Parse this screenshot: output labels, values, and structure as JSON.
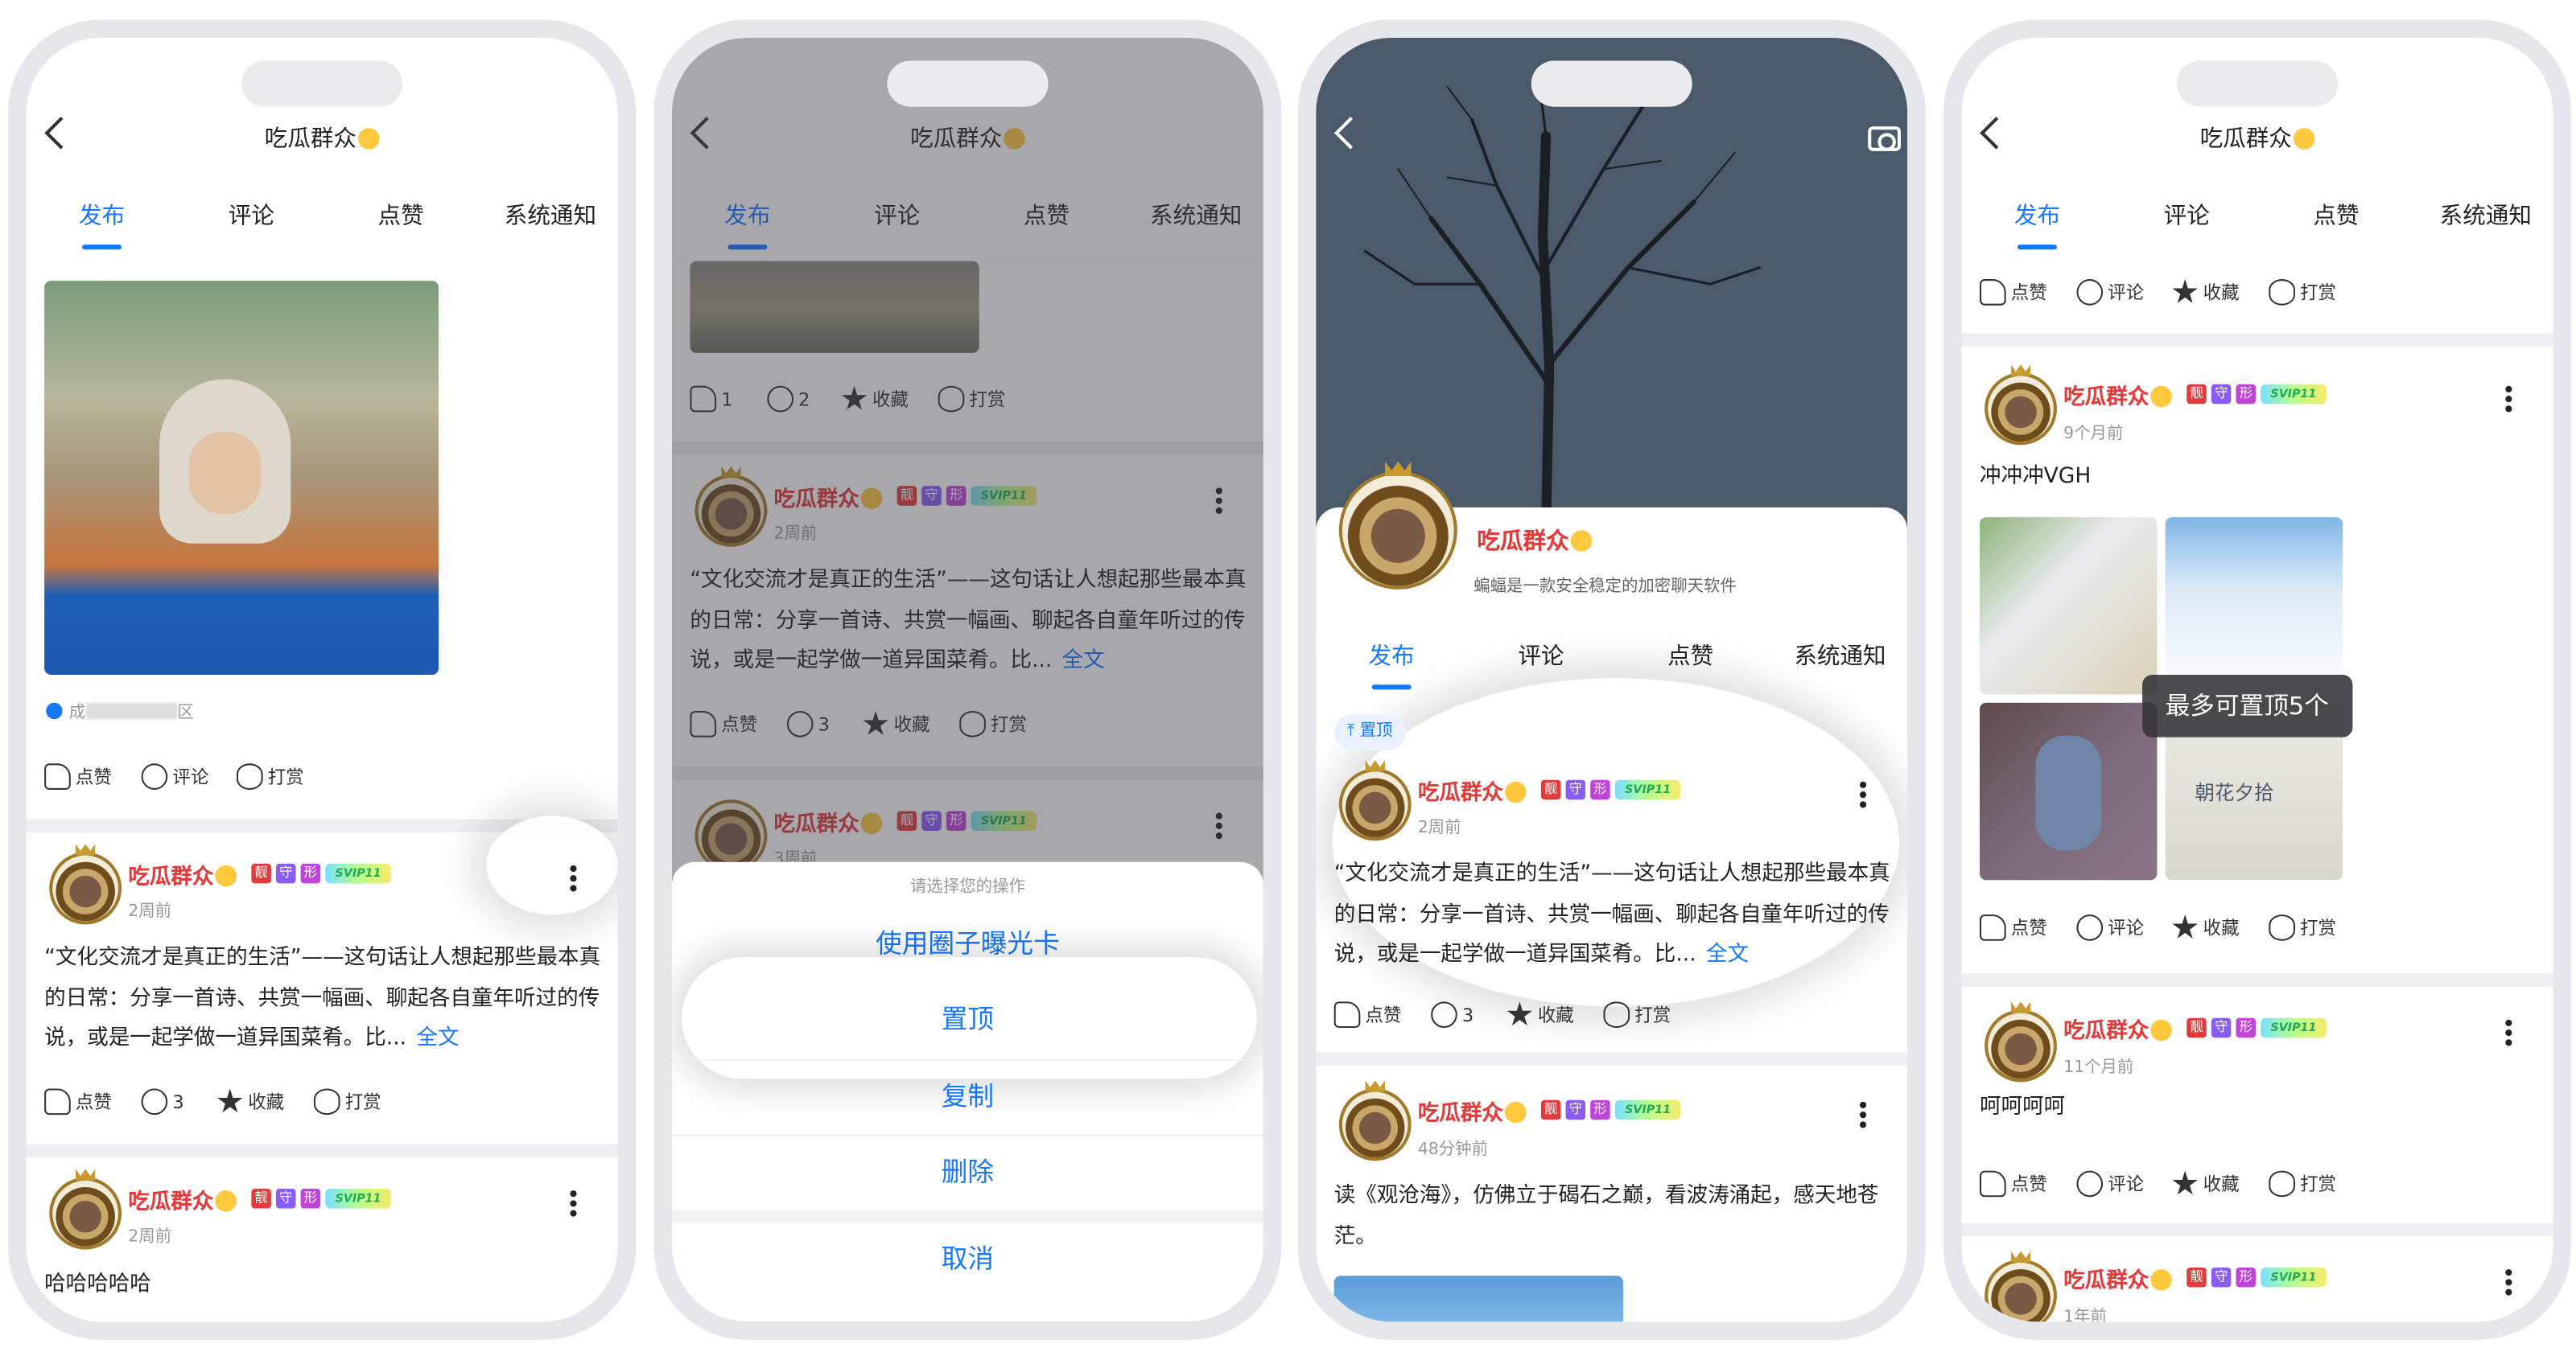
{
  "title": "吃瓜群众",
  "tabs": [
    "发布",
    "评论",
    "点赞",
    "系统通知"
  ],
  "user": {
    "name": "吃瓜群众",
    "badges": [
      "靓",
      "守",
      "形"
    ],
    "svip": "SVIP11",
    "signature": "蝙蝠是一款安全稳定的加密聊天软件"
  },
  "colors": {
    "accent": "#1677ff",
    "username": "#e33b3b",
    "background": "#efeff3"
  },
  "icons": [
    "back-arrow-icon",
    "camera-icon",
    "more-vertical-icon",
    "like-icon",
    "comment-icon",
    "favorite-icon",
    "tip-icon",
    "pin-icon",
    "location-icon"
  ],
  "actions": {
    "like": "点赞",
    "comment": "评论",
    "favorite": "收藏",
    "tip": "打赏"
  },
  "posts": {
    "culture": "“文化交流才是真正的生活”——这句话让人想起那些最本真的日常：分享一首诗、共赏一幅画、聊起各自童年听过的传说，或是一起学做一道异国菜肴。比...",
    "more_label": "全文",
    "haha": "哈哈哈哈哈",
    "sea": "读《观沧海》，仿佛立于碣石之巅，看波涛涌起，感天地苍茫。",
    "vgh": "冲冲冲VGH",
    "hehe": "呵呵呵呵"
  },
  "times": {
    "two_weeks": "2周前",
    "three_weeks": "3周前",
    "forty_eight_min": "48分钟前",
    "nine_months": "9个月前",
    "eleven_months": "11个月前",
    "one_year": "1年前"
  },
  "counts": {
    "likes": "1",
    "comments": "2",
    "comments_b": "3"
  },
  "location_prefix": "成",
  "location_suffix": "区",
  "sheet": {
    "title": "请选择您的操作",
    "options": [
      "使用圈子曝光卡",
      "置顶",
      "复制",
      "删除"
    ],
    "cancel": "取消"
  },
  "pin_label": "置顶",
  "toast": "最多可置顶5个",
  "thumbnail_caption": "朝花夕拾"
}
